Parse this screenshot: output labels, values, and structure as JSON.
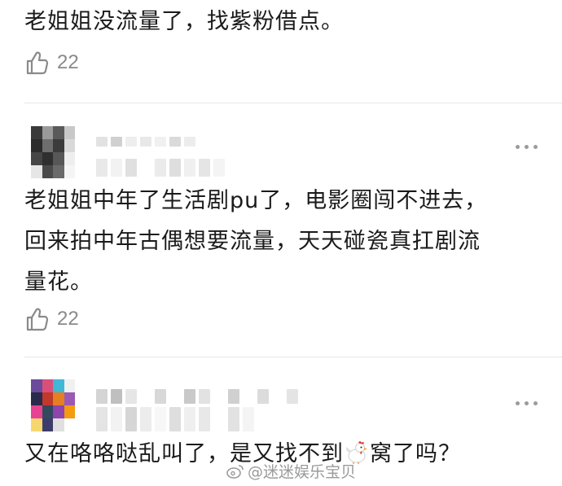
{
  "comments": [
    {
      "text_lines": [
        "老姐姐没流量了，找紫粉借点。"
      ],
      "likes": "22"
    },
    {
      "text_lines": [
        "老姐姐中年了生活剧pu了，电影圈闯不进去，",
        "回来拍中年古偶想要流量，天天碰瓷真扛剧流",
        "量花。"
      ],
      "likes": "22"
    },
    {
      "text_before_emoji": "又在咯咯哒乱叫了，是又找不到",
      "emoji": "rooster-emoji",
      "text_after_emoji": "窝了吗？"
    }
  ],
  "icons": {
    "like": "thumbs-up-icon",
    "more": "more-dots-icon"
  },
  "watermark": "@迷迷娱乐宝贝",
  "colors": {
    "text": "#1a1a1a",
    "muted": "#8a8a8a",
    "divider": "#e6e6e6"
  }
}
